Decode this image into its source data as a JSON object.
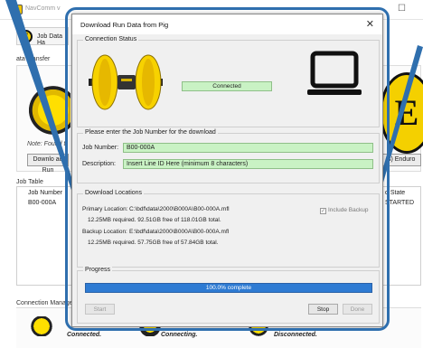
{
  "background_app": {
    "window_title": "NavComm v",
    "tab_label": "Job Data Ha",
    "data_transfer_label": "ata Transfer",
    "note_text": "Note: Found t",
    "download_button": "Downlo ad Run",
    "enduro_button": "(s) Enduro",
    "job_table_label": "Job Table",
    "job_table_col_header": "Job Number",
    "job_table_state_header": "d State",
    "job_table_row_job": "B00-000A",
    "job_table_row_state": "STARTED",
    "connection_manager_label": "Connection Manager",
    "status_connected": "Connected.",
    "status_connecting": "Connecting.",
    "status_disconnected": "Disconnected.",
    "logo_letter": "E",
    "big_logo_letter": "E"
  },
  "dialog": {
    "title": "Download Run Data from Pig",
    "close_glyph": "✕",
    "connection_status": {
      "legend": "Connection Status",
      "status": "Connected"
    },
    "job_entry": {
      "legend": "Please enter the Job Number for the download",
      "job_number_label": "Job Number:",
      "job_number_value": "B00-000A",
      "description_label": "Description:",
      "description_value": "Insert Line ID Here (minimum 8 characters)"
    },
    "locations": {
      "legend": "Download Locations",
      "primary_label": "Primary Location:",
      "primary_path": "C:\\bdf\\data\\2000\\B000A\\B00-000A.mfl",
      "primary_space": "12.25MB required. 92.51GB free of 118.01GB total.",
      "backup_label": "Backup Location:",
      "backup_path": "E:\\bdf\\data\\2000\\B000A\\B00-000A.mfl",
      "backup_space": "12.25MB required. 57.75GB free of 57.84GB total.",
      "include_backup_label": "Include Backup",
      "include_backup_checked": true
    },
    "progress": {
      "legend": "Progress",
      "text": "100.0% complete",
      "fraction": 1.0,
      "start_label": "Start",
      "stop_label": "Stop",
      "done_label": "Done"
    }
  },
  "colors": {
    "highlight": "#2f6fae",
    "status_green": "#c9f2c4",
    "progress_blue": "#2e7bd3",
    "logo_yellow": "#f4d000"
  }
}
